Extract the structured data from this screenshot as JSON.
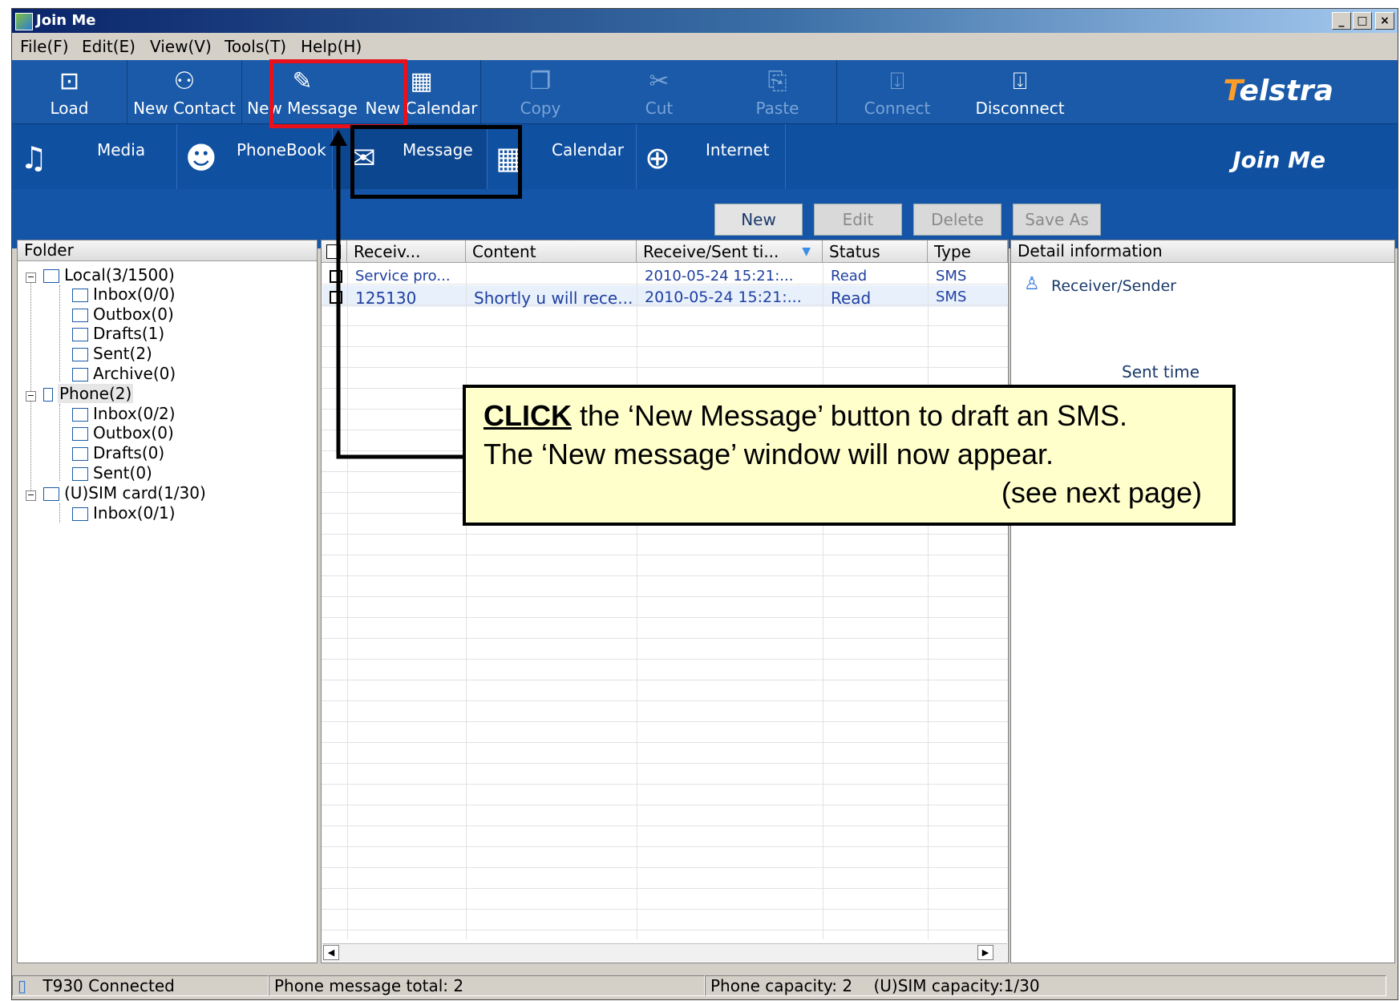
{
  "window": {
    "title": "Join Me",
    "min": "_",
    "max": "□",
    "close": "×"
  },
  "menu": [
    "File(F)",
    "Edit(E)",
    "View(V)",
    "Tools(T)",
    "Help(H)"
  ],
  "toolbar": {
    "load": "Load",
    "new_contact": "New Contact",
    "new_message": "New Message",
    "new_calendar": "New Calendar",
    "copy": "Copy",
    "cut": "Cut",
    "paste": "Paste",
    "connect": "Connect",
    "disconnect": "Disconnect",
    "brand": "Telstra"
  },
  "nav": {
    "media": "Media",
    "phonebook": "PhoneBook",
    "message": "Message",
    "calendar": "Calendar",
    "internet": "Internet",
    "brand": "Join Me"
  },
  "actions": {
    "new": "New",
    "edit": "Edit",
    "delete": "Delete",
    "save_as": "Save As"
  },
  "folder": {
    "header": "Folder",
    "local": "Local(3/1500)",
    "local_inbox": "Inbox(0/0)",
    "local_outbox": "Outbox(0)",
    "local_drafts": "Drafts(1)",
    "local_sent": "Sent(2)",
    "local_archive": "Archive(0)",
    "phone": "Phone(2)",
    "phone_inbox": "Inbox(0/2)",
    "phone_outbox": "Outbox(0)",
    "phone_drafts": "Drafts(0)",
    "phone_sent": "Sent(0)",
    "sim": "(U)SIM card(1/30)",
    "sim_inbox": "Inbox(0/1)"
  },
  "table": {
    "headers": [
      "Receiv...",
      "Content",
      "Receive/Sent ti...",
      "Status",
      "Type"
    ],
    "rows": [
      {
        "receiver": "Service pro...",
        "content": "",
        "time": "2010-05-24  15:21:...",
        "status": "Read",
        "type": "SMS"
      },
      {
        "receiver": "125130",
        "content": "Shortly u will rece...",
        "time": "2010-05-24  15:21:...",
        "status": "Read",
        "type": "SMS"
      }
    ]
  },
  "detail": {
    "header": "Detail information",
    "receiver_sender": "Receiver/Sender",
    "sent_time": "Sent time"
  },
  "status": {
    "connected": "T930 Connected",
    "total": "Phone message total: 2",
    "phone_capacity": "Phone capacity: 2",
    "sim_capacity": "(U)SIM  capacity:1/30"
  },
  "callout": {
    "click": "CLICK",
    "line1_rest": " the ‘New Message’ button to draft an SMS.",
    "line2": "The ‘New message’ window will now appear.",
    "line3": "(see next page)"
  },
  "colors": {
    "toolbar_blue": "#1a5aa8",
    "highlight_red": "#e8101a",
    "callout_bg": "#ffffcc",
    "brand_orange": "#ff9d2a"
  }
}
